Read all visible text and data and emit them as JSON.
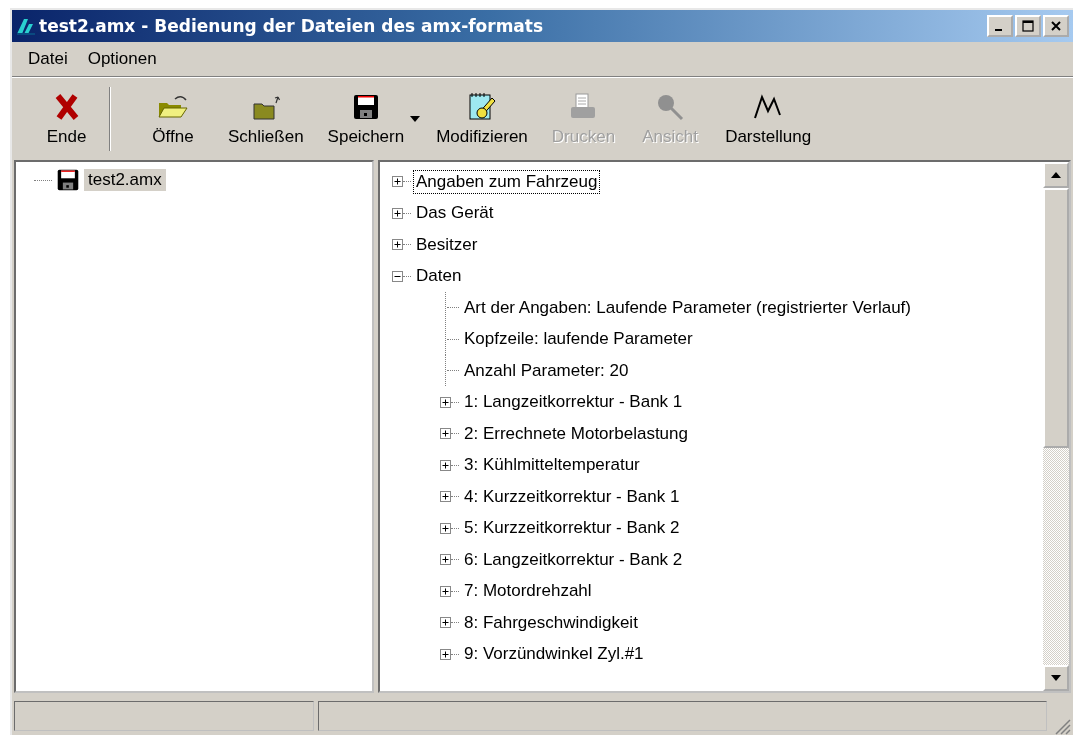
{
  "window": {
    "title": "test2.amx - Bedienung der Dateien des amx-formats"
  },
  "menu": [
    "Datei",
    "Optionen"
  ],
  "toolbar": [
    {
      "label": "Ende",
      "kind": "close",
      "disabled": false,
      "separator_after": true,
      "dropdown": false
    },
    {
      "label": "Öffne",
      "kind": "open",
      "disabled": false,
      "separator_after": false,
      "dropdown": false
    },
    {
      "label": "Schließen",
      "kind": "shut",
      "disabled": false,
      "separator_after": false,
      "dropdown": false
    },
    {
      "label": "Speichern",
      "kind": "save",
      "disabled": false,
      "separator_after": false,
      "dropdown": true
    },
    {
      "label": "Modifizieren",
      "kind": "edit",
      "disabled": false,
      "separator_after": false,
      "dropdown": false
    },
    {
      "label": "Drucken",
      "kind": "print",
      "disabled": true,
      "separator_after": false,
      "dropdown": false
    },
    {
      "label": "Ansicht",
      "kind": "view",
      "disabled": true,
      "separator_after": false,
      "dropdown": false
    },
    {
      "label": "Darstellung",
      "kind": "chart",
      "disabled": false,
      "separator_after": false,
      "dropdown": false
    }
  ],
  "files": [
    {
      "label": "test2.amx",
      "selected": true
    }
  ],
  "tree": [
    {
      "label": "Angaben zum Fahrzeug",
      "kind": "group",
      "expanded": false,
      "focused": true
    },
    {
      "label": "Das Gerät",
      "kind": "group",
      "expanded": false,
      "focused": false
    },
    {
      "label": "Besitzer",
      "kind": "group",
      "expanded": false,
      "focused": false
    },
    {
      "label": "Daten",
      "kind": "group",
      "expanded": true,
      "focused": false,
      "children": [
        {
          "label": "Art der Angaben: Laufende Parameter (registrierter Verlauf)",
          "kind": "leaf",
          "focused": false
        },
        {
          "label": "Kopfzeile: laufende Parameter",
          "kind": "leaf",
          "focused": false
        },
        {
          "label": "Anzahl Parameter: 20",
          "kind": "leaf",
          "focused": false
        },
        {
          "label": "1: Langzeitkorrektur - Bank 1",
          "kind": "group",
          "expanded": false,
          "focused": false
        },
        {
          "label": "2: Errechnete Motorbelastung",
          "kind": "group",
          "expanded": false,
          "focused": false
        },
        {
          "label": "3: Kühlmitteltemperatur",
          "kind": "group",
          "expanded": false,
          "focused": false
        },
        {
          "label": "4: Kurzzeitkorrektur - Bank 1",
          "kind": "group",
          "expanded": false,
          "focused": false
        },
        {
          "label": "5: Kurzzeitkorrektur - Bank 2",
          "kind": "group",
          "expanded": false,
          "focused": false
        },
        {
          "label": "6: Langzeitkorrektur - Bank 2",
          "kind": "group",
          "expanded": false,
          "focused": false
        },
        {
          "label": "7: Motordrehzahl",
          "kind": "group",
          "expanded": false,
          "focused": false
        },
        {
          "label": "8: Fahrgeschwindigkeit",
          "kind": "group",
          "expanded": false,
          "focused": false
        },
        {
          "label": "9: Vorzündwinkel Zyl.#1",
          "kind": "group",
          "expanded": false,
          "focused": false
        }
      ]
    }
  ]
}
